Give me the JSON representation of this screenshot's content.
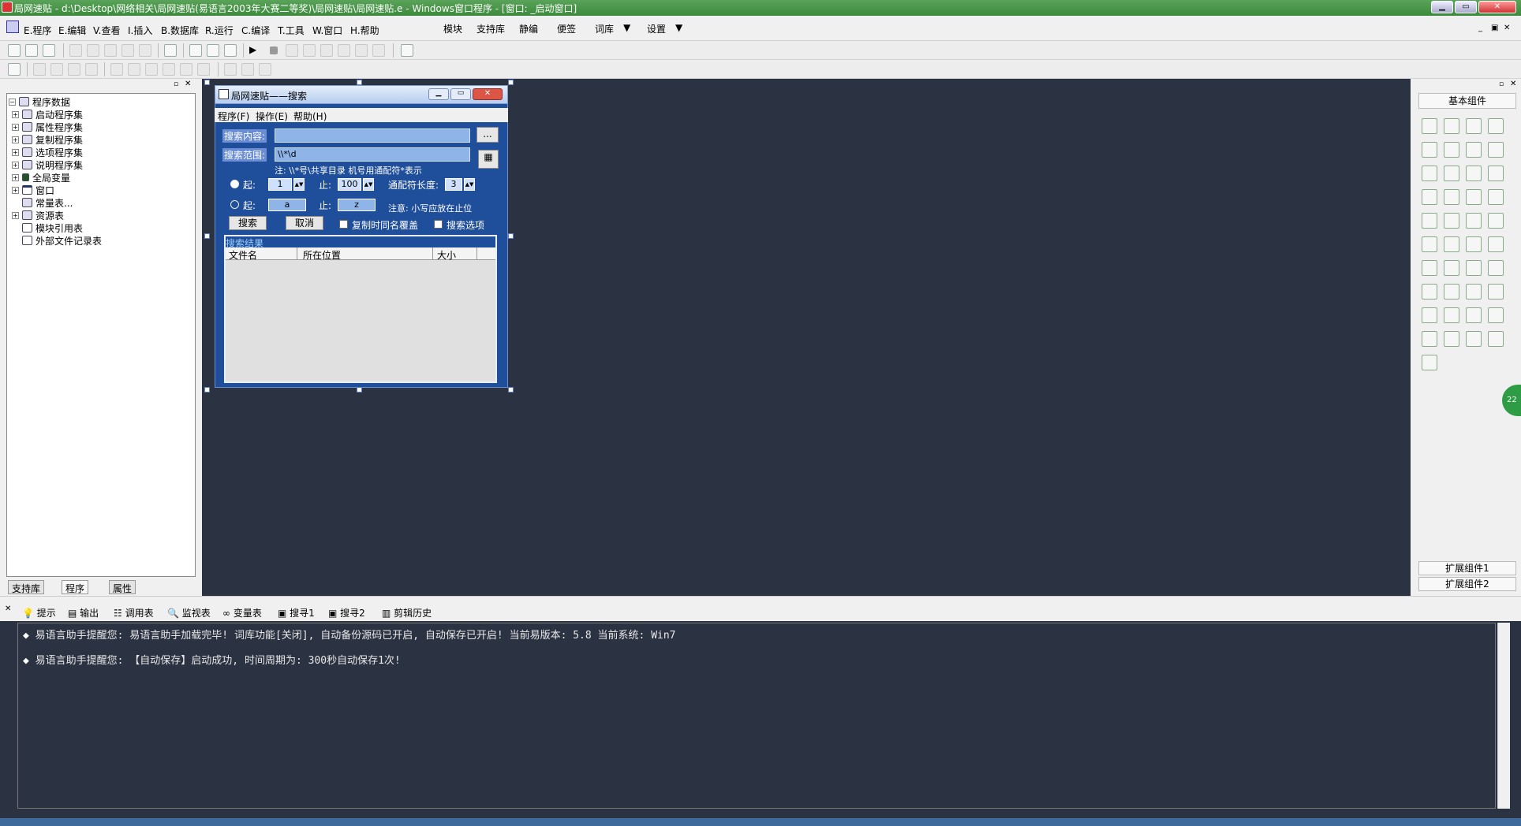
{
  "window": {
    "title": "局网速贴 - d:\\Desktop\\网络相关\\局网速贴(易语言2003年大赛二等奖)\\局网速贴\\局网速贴.e - Windows窗口程序 - [窗口: _启动窗口]"
  },
  "menubar": {
    "items": [
      "E.程序",
      "E.编辑",
      "V.查看",
      "I.插入",
      "B.数据库",
      "R.运行",
      "C.编译",
      "T.工具",
      "W.窗口",
      "H.帮助"
    ],
    "extra": [
      "模块",
      "支持库",
      "静编",
      "便签",
      "词库",
      "设置"
    ]
  },
  "left_panel": {
    "root": "程序数据",
    "nodes": [
      "启动程序集",
      "属性程序集",
      "复制程序集",
      "选项程序集",
      "说明程序集",
      "全局变量",
      "窗口",
      "常量表...",
      "资源表",
      "模块引用表",
      "外部文件记录表"
    ],
    "tabs": [
      "支持库",
      "程序",
      "属性"
    ]
  },
  "form": {
    "title": "局网速贴——搜索",
    "menu": [
      "程序(F)",
      "操作(E)",
      "帮助(H)"
    ],
    "search_content_label": "搜索内容:",
    "browse_button": "...",
    "search_range_label": "搜索范围:",
    "search_range_value": "\\\\*\\d",
    "note1": "注:  \\\\*号\\共享目录  机号用通配符*表示",
    "from_label": "起:",
    "from_value": "1",
    "to_label": "止:",
    "to_value": "100",
    "wildcard_label": "通配符长度:",
    "wildcard_value": "3",
    "from2_label": "起:",
    "from2_value": "a",
    "to2_label": "止:",
    "to2_value": "z",
    "note2": "注意: 小写应放在止位",
    "search_button": "搜索",
    "cancel_button": "取消",
    "overwrite_checkbox": "复制时同名覆盖",
    "options_checkbox": "搜索选项",
    "results_group": "搜索结果",
    "columns": [
      "文件名",
      "所在位置",
      "大小"
    ]
  },
  "right_panel": {
    "header": "基本组件",
    "ext1": "扩展组件1",
    "ext2": "扩展组件2"
  },
  "output_tabs": [
    "提示",
    "输出",
    "调用表",
    "监视表",
    "变量表",
    "搜寻1",
    "搜寻2",
    "剪辑历史"
  ],
  "output_lines": [
    "易语言助手提醒您:  易语言助手加载完毕! 词库功能[关闭], 自动备份源码已开启, 自动保存已开启!  当前易版本: 5.8  当前系统: Win7",
    "易语言助手提醒您: 【自动保存】启动成功, 时间周期为: 300秒自动保存1次!"
  ],
  "badge": "22"
}
